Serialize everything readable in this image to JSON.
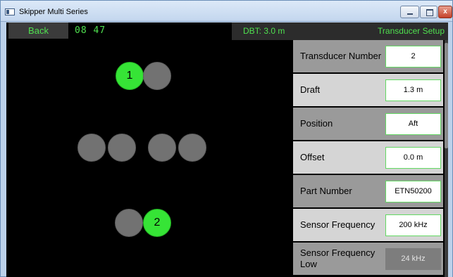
{
  "window": {
    "title": "Skipper Multi Series",
    "close_glyph": "x"
  },
  "topbar": {
    "back_label": "Back",
    "clock": "08 47",
    "dbt": "DBT: 3.0 m",
    "screen_title": "Transducer Setup"
  },
  "diagram": {
    "active_labels": [
      "1",
      "2"
    ]
  },
  "settings": [
    {
      "label": "Transducer Number",
      "value": "2",
      "enabled": true
    },
    {
      "label": "Draft",
      "value": "1.3 m",
      "enabled": true
    },
    {
      "label": "Position",
      "value": "Aft",
      "enabled": true
    },
    {
      "label": "Offset",
      "value": "0.0 m",
      "enabled": true
    },
    {
      "label": "Part Number",
      "value": "ETN50200",
      "enabled": true
    },
    {
      "label": "Sensor Frequency",
      "value": "200 kHz",
      "enabled": true
    },
    {
      "label": "Sensor Frequency Low",
      "value": "24 kHz",
      "enabled": false
    }
  ],
  "colors": {
    "accent_green": "#4fe04f",
    "active_dot": "#36e436",
    "inactive_dot": "#727272"
  }
}
